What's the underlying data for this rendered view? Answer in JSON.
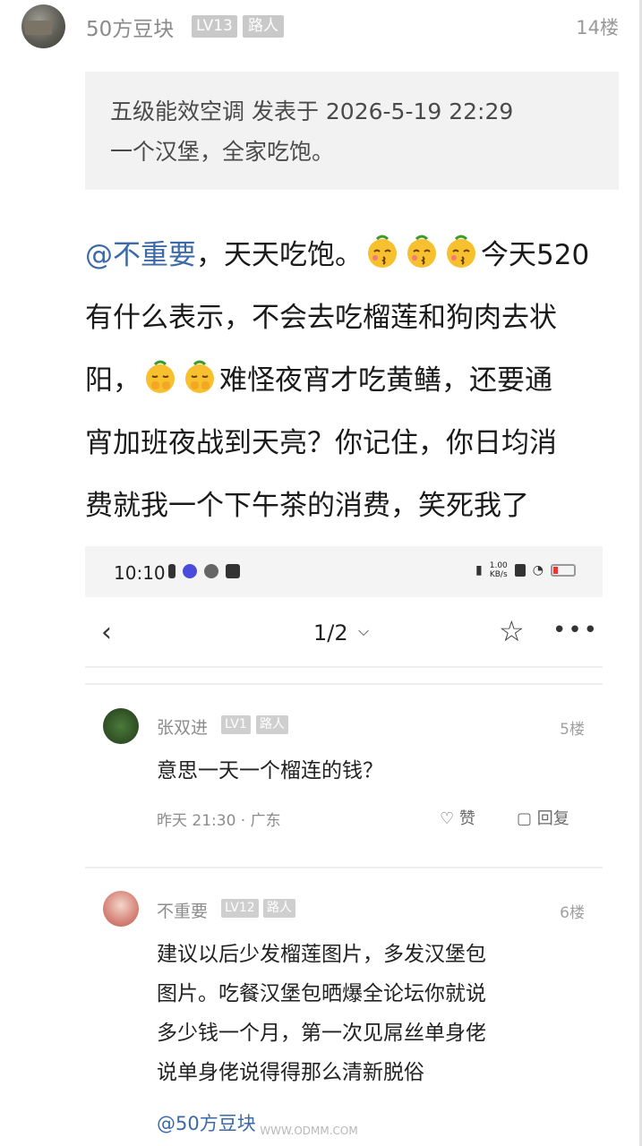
{
  "post": {
    "username": "50方豆块",
    "level": "LV13",
    "role": "路人",
    "floor": "14楼"
  },
  "quote": {
    "line1": "五级能效空调 发表于 2026-5-19 22:29",
    "line2": "一个汉堡，全家吃饱。"
  },
  "content": {
    "mention": "@不重要",
    "seg1": "，天天吃饱。",
    "seg2": "今天520",
    "line2": "有什么表示，不会去吃榴莲和狗肉去状",
    "seg3": "阳，",
    "seg4": "难怪夜宵才吃黄鳝，还要通",
    "line4": "宵加班夜战到天亮？你记住，你日均消",
    "line5": "费就我一个下午茶的消费，笑死我了",
    "emoji_kiss": "kiss-emoji",
    "emoji_shy": "shy-emoji"
  },
  "screenshot": {
    "status_time": "10:10",
    "net_speed_value": "1.00",
    "net_speed_unit": "KB/s",
    "page_indicator": "1/2",
    "comments": [
      {
        "name": "张双进",
        "level": "LV1",
        "role": "路人",
        "floor": "5楼",
        "text": "意思一天一个榴连的钱？",
        "meta": "昨天 21:30 · 广东",
        "like_label": "赞",
        "reply_label": "回复"
      },
      {
        "name": "不重要",
        "level": "LV12",
        "role": "路人",
        "floor": "6楼",
        "lines": [
          "建议以后少发榴莲图片，多发汉堡包",
          "图片。吃餐汉堡包晒爆全论坛你就说",
          "多少钱一个月，第一次见屌丝单身佬",
          "说单身佬说得得那么清新脱俗"
        ],
        "mention": "@50方豆块"
      }
    ]
  },
  "watermark": "WWW.ODMM.COM",
  "colors": {
    "link": "#3b6aa8",
    "muted": "#8a8a8a",
    "quote_bg": "#f2f2f2"
  }
}
